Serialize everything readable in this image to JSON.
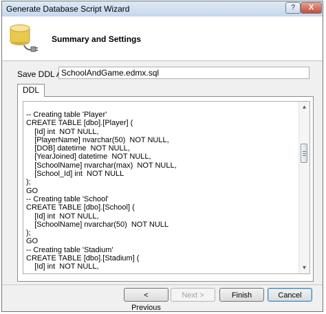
{
  "window": {
    "title": "Generate Database Script Wizard",
    "help_label": "?",
    "close_label": "X"
  },
  "header": {
    "title": "Summary and Settings",
    "icon": "database-plug-icon"
  },
  "ddl": {
    "label": "Save DDL As:",
    "value": "SchoolAndGame.edmx.sql"
  },
  "tab": {
    "label": "DDL"
  },
  "script": {
    "lines": [
      "-- Creating table 'Player'",
      "CREATE TABLE [dbo].[Player] (",
      "    [Id] int  NOT NULL,",
      "    [PlayerName] nvarchar(50)  NOT NULL,",
      "    [DOB] datetime  NOT NULL,",
      "    [YearJoined] datetime  NOT NULL,",
      "    [SchoolName] nvarchar(max)  NOT NULL,",
      "    [School_Id] int  NOT NULL",
      ");",
      "GO",
      "-- Creating table 'School'",
      "CREATE TABLE [dbo].[School] (",
      "    [Id] int  NOT NULL,",
      "    [SchoolName] nvarchar(50)  NOT NULL",
      ");",
      "GO",
      "-- Creating table 'Stadium'",
      "CREATE TABLE [dbo].[Stadium] (",
      "    [Id] int  NOT NULL,"
    ]
  },
  "buttons": {
    "previous": "< Previous",
    "next": "Next >",
    "finish": "Finish",
    "cancel": "Cancel"
  },
  "colors": {
    "title_bar": "#c6d7ec",
    "close_button": "#c74a34",
    "dialog_body": "#f0f0f0"
  }
}
